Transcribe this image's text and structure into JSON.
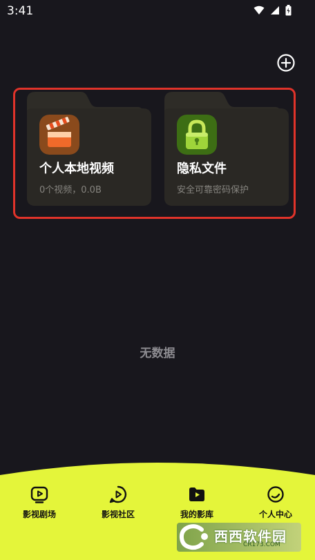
{
  "status_bar": {
    "time": "3:41"
  },
  "header": {
    "add_icon": "plus-circle-icon"
  },
  "folders": [
    {
      "title": "个人本地视频",
      "subtitle": "0个视频，0.0B",
      "icon": "clapperboard-icon"
    },
    {
      "title": "隐私文件",
      "subtitle": "安全可靠密码保护",
      "icon": "lock-icon"
    }
  ],
  "empty_state": {
    "text": "无数据"
  },
  "bottom_nav": {
    "items": [
      {
        "label": "影视剧场",
        "icon": "tv-play-icon"
      },
      {
        "label": "影视社区",
        "icon": "community-play-icon"
      },
      {
        "label": "我的影库",
        "icon": "folder-play-icon",
        "active": true
      },
      {
        "label": "个人中心",
        "icon": "profile-icon"
      }
    ]
  },
  "watermark": {
    "text": "西西软件园",
    "sub": "CR173.COM"
  },
  "colors": {
    "background": "#18171d",
    "card": "#2b2925",
    "nav_bar": "#e4f53a",
    "highlight": "#e0332a"
  }
}
